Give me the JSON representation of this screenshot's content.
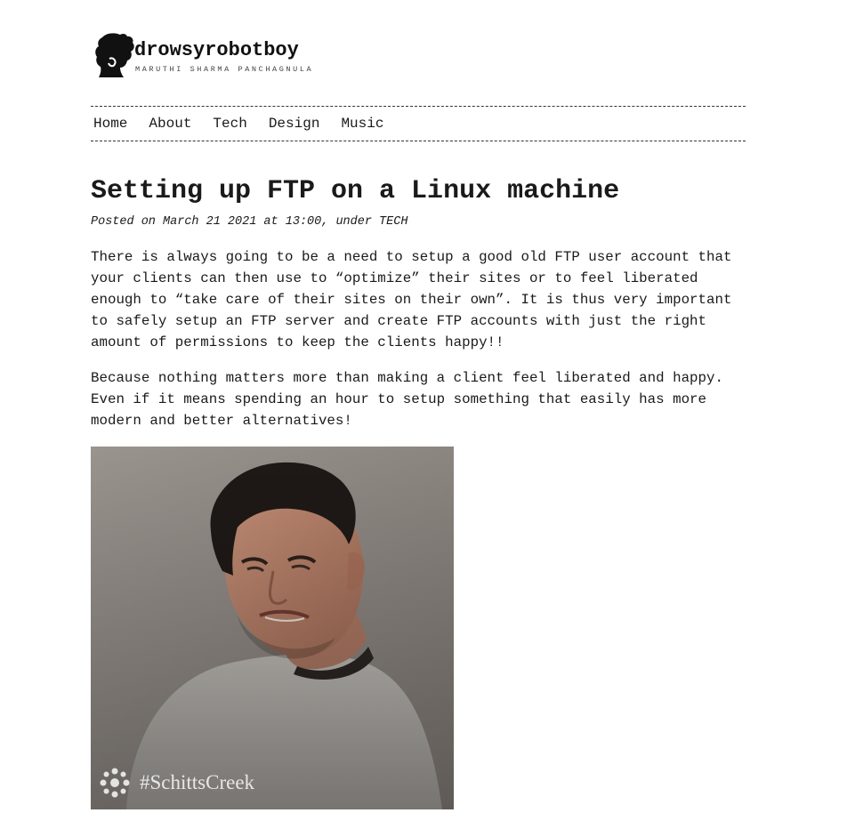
{
  "site": {
    "title": "drowsyrobotboy",
    "subtitle": "MARUTHI SHARMA PANCHAGNULA",
    "logo_icon": "silhouette-logo-icon"
  },
  "nav": {
    "items": [
      {
        "label": "Home"
      },
      {
        "label": "About"
      },
      {
        "label": "Tech"
      },
      {
        "label": "Design"
      },
      {
        "label": "Music"
      }
    ]
  },
  "post": {
    "title": "Setting up FTP on a Linux machine",
    "meta": "Posted on March 21 2021 at 13:00, under TECH",
    "paragraphs": [
      "There is always going to be a need to setup a good old FTP user account that your clients can then use to “optimize” their sites or to feel liberated enough to “take care of their sites on their own”. It is thus very important to safely setup an FTP server and create FTP accounts with just the right amount of permissions to keep the clients happy!!",
      "Because nothing matters more than making a client feel liberated and happy. Even if it means spending an hour to setup something that easily has more modern and better alternatives!"
    ],
    "image": {
      "caption": "#SchittsCreek",
      "watermark_icon": "cbc-gem-icon"
    }
  },
  "colors": {
    "text": "#1a1a1a",
    "background": "#ffffff",
    "image_background": "#8f8983"
  }
}
